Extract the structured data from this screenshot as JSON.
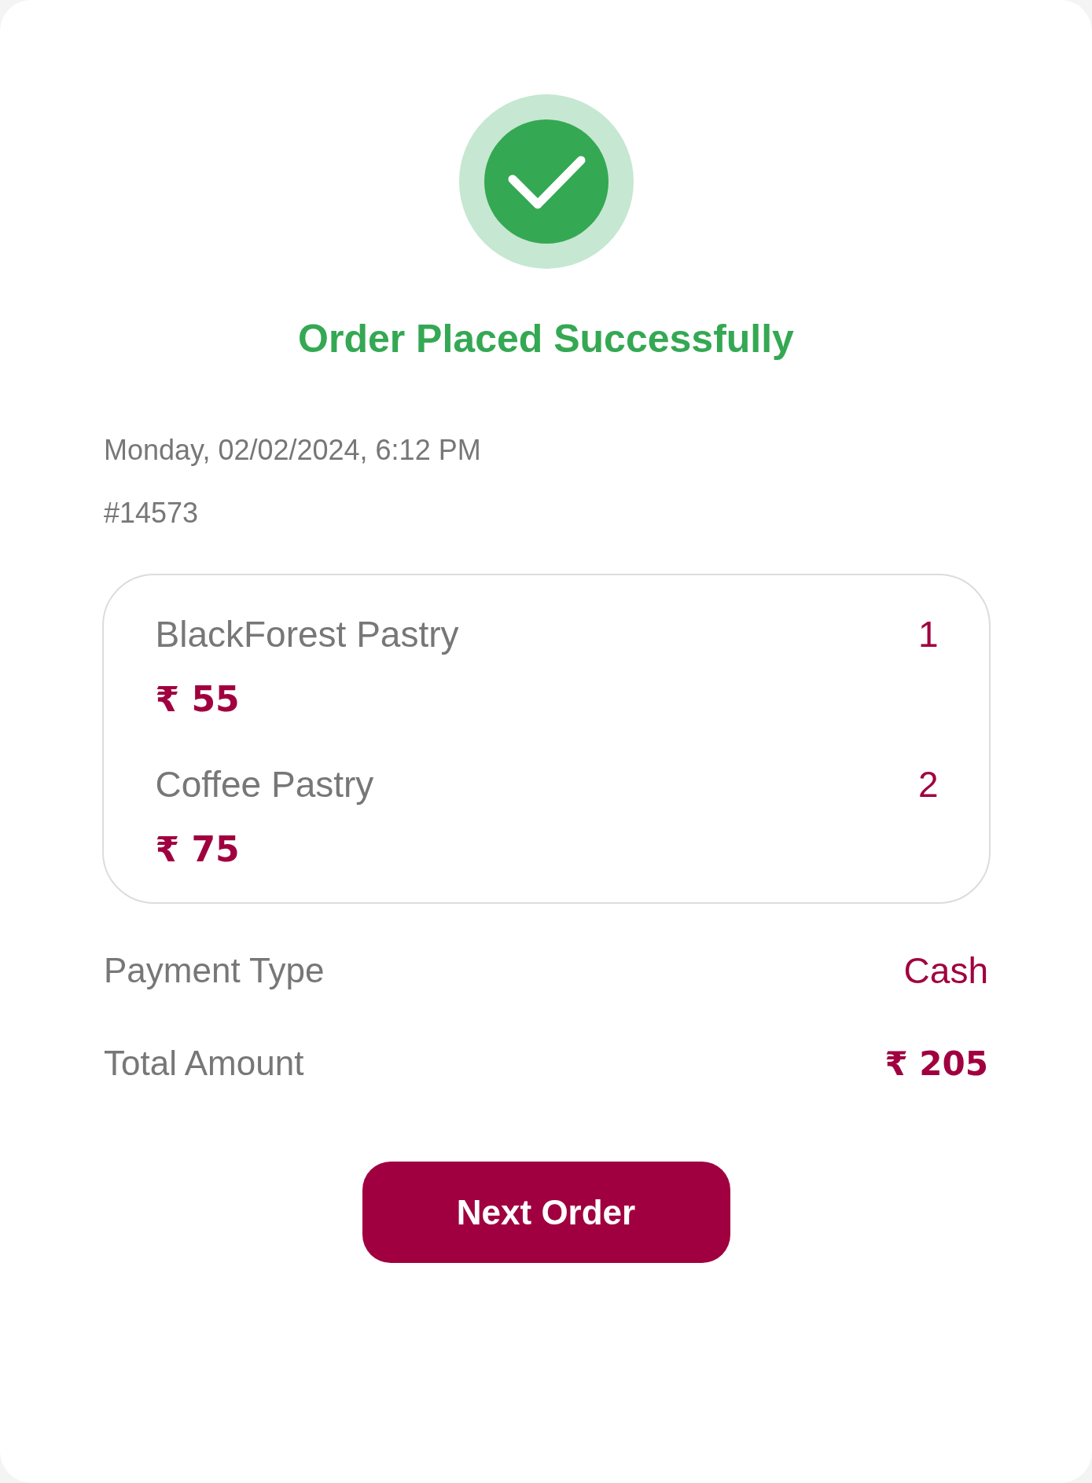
{
  "status": {
    "title": "Order Placed Successfully"
  },
  "order": {
    "datetime": "Monday, 02/02/2024, 6:12 PM",
    "number": "#14573"
  },
  "items": [
    {
      "name": "BlackForest Pastry",
      "price": "₹ 55",
      "quantity": "1"
    },
    {
      "name": "Coffee Pastry",
      "price": "₹ 75",
      "quantity": "2"
    }
  ],
  "summary": [
    {
      "label": "Payment Type",
      "value": "Cash"
    },
    {
      "label": "Total Amount",
      "value": "₹ 205"
    }
  ],
  "button": {
    "label": "Next Order"
  }
}
